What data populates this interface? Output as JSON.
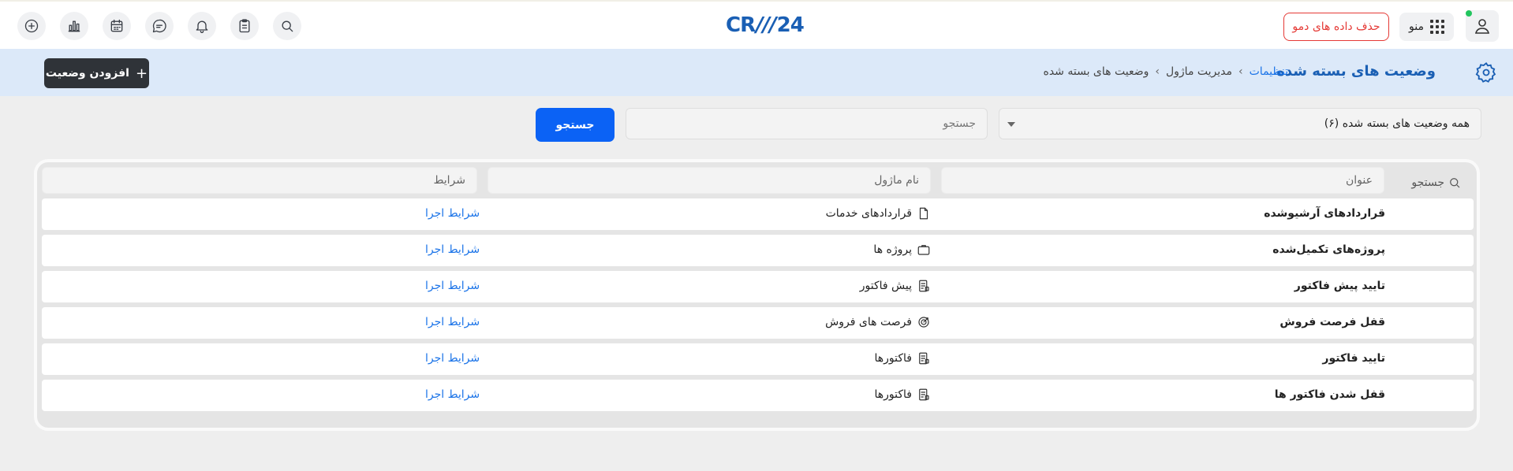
{
  "topbar": {
    "logo_prefix": "CR",
    "logo_slashes": "///",
    "logo_suffix": "24",
    "demo_delete_label": "حذف داده های دمو",
    "menu_label": "منو"
  },
  "header": {
    "title": "وضعیت های بسته شده",
    "breadcrumb": {
      "settings": "تنظیمات",
      "module_management": "مدیریت ماژول",
      "current": "وضعیت های بسته شده",
      "separator": "›"
    },
    "add_button_label": "افزودن وضعیت",
    "add_button_plus": "+"
  },
  "filters": {
    "select_value": "همه وضعیت های بسته شده (۶)",
    "search_placeholder": "جستجو",
    "search_button_label": "جستجو"
  },
  "table": {
    "search_label": "جستجو",
    "columns": {
      "title": "عنوان",
      "module": "نام ماژول",
      "conditions": "شرایط"
    },
    "rows": [
      {
        "title": "قراردادهای آرشیوشده",
        "module": "قراردادهای خدمات",
        "module_icon": "document-icon",
        "condition": "شرایط اجرا"
      },
      {
        "title": "پروژه‌های تکمیل‌شده",
        "module": "پروژه ها",
        "module_icon": "briefcase-icon",
        "condition": "شرایط اجرا"
      },
      {
        "title": "تایید پیش فاکتور",
        "module": "پیش فاکتور",
        "module_icon": "invoice-icon",
        "condition": "شرایط اجرا"
      },
      {
        "title": "قفل فرصت فروش",
        "module": "فرصت های فروش",
        "module_icon": "target-icon",
        "condition": "شرایط اجرا"
      },
      {
        "title": "تایید فاکتور",
        "module": "فاکتورها",
        "module_icon": "invoice-icon",
        "condition": "شرایط اجرا"
      },
      {
        "title": "قفل شدن فاکتور ها",
        "module": "فاکتورها",
        "module_icon": "invoice-icon",
        "condition": "شرایط اجرا"
      }
    ]
  },
  "colors": {
    "brand": "#1a5fb4",
    "primary_button": "#0b62f5",
    "danger": "#e53935",
    "header_band": "#dce9f9",
    "link": "#1a73e8",
    "online": "#22c55e"
  }
}
